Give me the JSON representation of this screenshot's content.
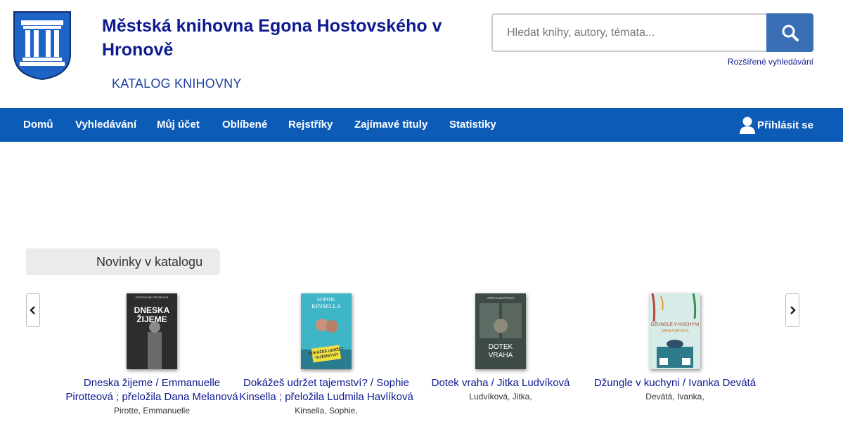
{
  "header": {
    "library_name": "Městská knihovna Egona Hostovského v Hronově",
    "catalog_label": "KATALOG KNIHOVNY"
  },
  "search": {
    "placeholder": "Hledat knihy, autory, témata...",
    "button_icon": "search-icon",
    "advanced_link": "Rozšířené vyhledávání"
  },
  "nav": {
    "items": [
      "Domů",
      "Vyhledávání",
      "Můj účet",
      "Oblíbené",
      "Rejstříky",
      "Zajímavé tituly",
      "Statistiky"
    ],
    "login": "Přihlásit se",
    "login_icon": "user-icon",
    "color": "#0b5bb7"
  },
  "news": {
    "heading": "Novinky v katalogu",
    "prev_icon": "chevron-left-icon",
    "next_icon": "chevron-right-icon",
    "books": [
      {
        "title": "Dneska žijeme / Emmanuelle Pirotteová ; přeložila Dana Melanová",
        "author": "Pirotte, Emmanuelle",
        "cover_text": "DNESKA ŽIJEME",
        "cover_author": "Emmanuelle Pirotteová"
      },
      {
        "title": "Dokážeš udržet tajemství? / Sophie Kinsella ; přeložila Ludmila Havlíková",
        "author": "Kinsella, Sophie,",
        "cover_text": "DOKÁŽEŠ UDRŽET TAJEMSTVÍ?",
        "cover_author": "SOPHIE KINSELLA"
      },
      {
        "title": "Dotek vraha / Jitka Ludvíková",
        "author": "Ludvíková, Jitka,",
        "cover_text": "DOTEK VRAHA",
        "cover_author": "JITKA LUDVÍKOVÁ"
      },
      {
        "title": "Džungle v kuchyni / Ivanka Devátá",
        "author": "Devátá, Ivanka,",
        "cover_text": "DŽUNGLE V KUCHYNI",
        "cover_author": "IVANKA DEVÁTÁ"
      }
    ]
  }
}
